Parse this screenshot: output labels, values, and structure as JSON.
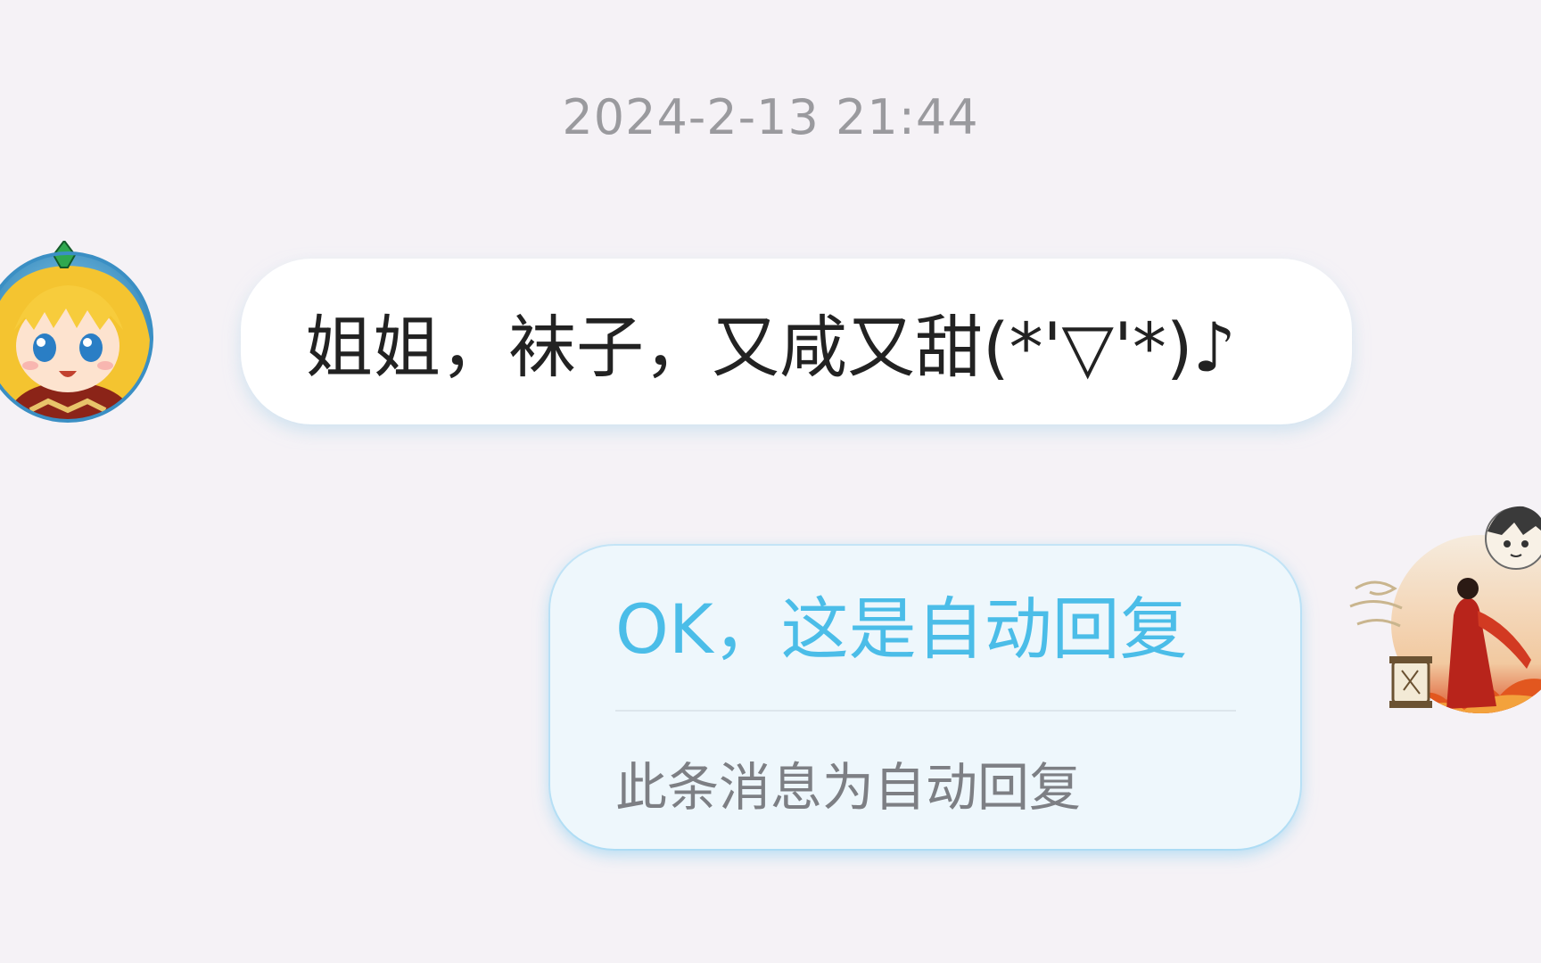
{
  "conversation": {
    "timestamp": "2024-2-13 21:44",
    "messages": [
      {
        "direction": "incoming",
        "avatar": "anime-blonde-girl-avatar",
        "text": "姐姐，袜子，又咸又甜(*'▽'*)♪"
      },
      {
        "direction": "outgoing",
        "avatar": "ink-painting-swordsman-avatar",
        "text": "OK，这是自动回复",
        "note": "此条消息为自动回复"
      }
    ]
  },
  "colors": {
    "background": "#f5f2f6",
    "incoming_bubble": "#ffffff",
    "outgoing_bubble": "#eef7fc",
    "auto_reply_text": "#4bbde8",
    "timestamp_text": "#9a9a9e"
  }
}
